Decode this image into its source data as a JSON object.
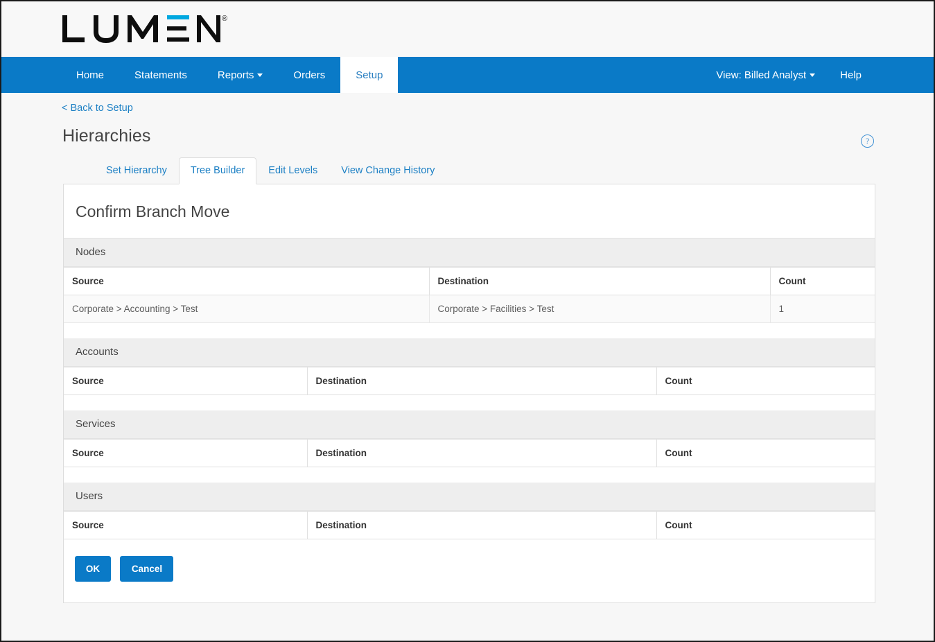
{
  "brand": {
    "logo_text": "LUMEN",
    "registered_mark": "®",
    "accent_color": "#00A8E0",
    "nav_color": "#0a7ac7",
    "link_color": "#1b7fc4"
  },
  "navbar": {
    "items": [
      {
        "label": "Home",
        "active": false,
        "has_caret": false
      },
      {
        "label": "Statements",
        "active": false,
        "has_caret": false
      },
      {
        "label": "Reports",
        "active": false,
        "has_caret": true
      },
      {
        "label": "Orders",
        "active": false,
        "has_caret": false
      },
      {
        "label": "Setup",
        "active": true,
        "has_caret": false
      }
    ],
    "right_items": [
      {
        "label": "View: Billed Analyst",
        "has_caret": true
      },
      {
        "label": "Help",
        "has_caret": false
      }
    ]
  },
  "page": {
    "back_link": "< Back to Setup",
    "title": "Hierarchies",
    "help_icon": "?"
  },
  "tabs": [
    {
      "label": "Set Hierarchy",
      "active": false
    },
    {
      "label": "Tree Builder",
      "active": true
    },
    {
      "label": "Edit Levels",
      "active": false
    },
    {
      "label": "View Change History",
      "active": false
    }
  ],
  "panel": {
    "heading": "Confirm Branch Move",
    "sections": [
      {
        "title": "Nodes",
        "columns": [
          "Source",
          "Destination",
          "Count"
        ],
        "rows": [
          [
            "Corporate > Accounting > Test",
            "Corporate > Facilities > Test",
            "1"
          ]
        ]
      },
      {
        "title": "Accounts",
        "columns": [
          "Source",
          "Destination",
          "Count"
        ],
        "rows": []
      },
      {
        "title": "Services",
        "columns": [
          "Source",
          "Destination",
          "Count"
        ],
        "rows": []
      },
      {
        "title": "Users",
        "columns": [
          "Source",
          "Destination",
          "Count"
        ],
        "rows": []
      }
    ],
    "buttons": [
      {
        "label": "OK",
        "wide": false
      },
      {
        "label": "Cancel",
        "wide": true
      }
    ]
  }
}
